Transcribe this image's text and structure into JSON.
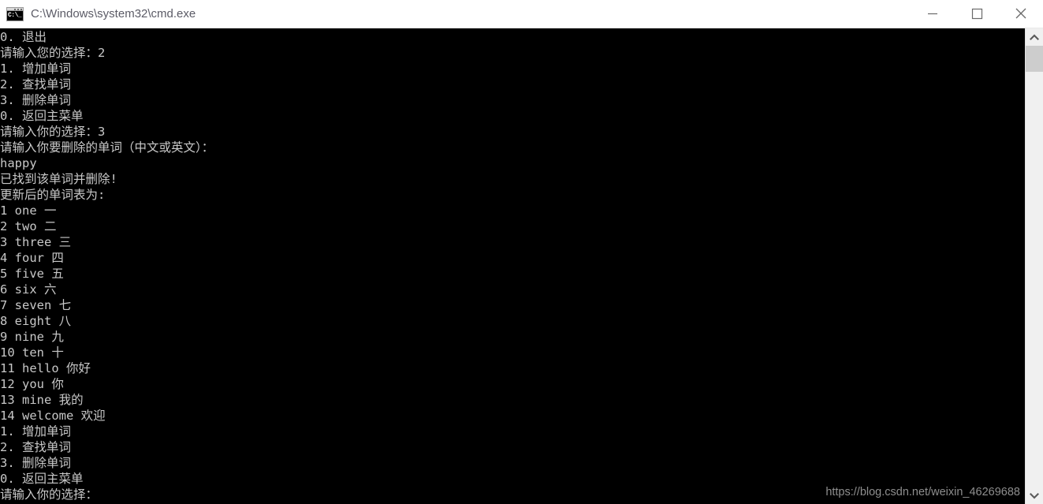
{
  "window": {
    "title": "C:\\Windows\\system32\\cmd.exe",
    "icon_name": "cmd-console-icon",
    "icon_glyph": "C:\\_",
    "controls": {
      "minimize_label": "Minimize",
      "maximize_label": "Maximize",
      "close_label": "Close"
    },
    "colors": {
      "titlebar_bg": "#ffffff",
      "title_text": "#5b5b66",
      "terminal_bg": "#000000",
      "terminal_text": "#c8c8c8",
      "scrollbar_track": "#f0f0f0",
      "scrollbar_thumb": "#cdcdcd",
      "watermark_text": "#8e8e8e"
    }
  },
  "terminal": {
    "lines": [
      "0. 退出",
      "请输入您的选择：2",
      "1. 增加单词",
      "2. 查找单词",
      "3. 删除单词",
      "0. 返回主菜单",
      "请输入你的选择：3",
      "请输入你要删除的单词（中文或英文）：",
      "happy",
      "已找到该单词并删除!",
      "更新后的单词表为:",
      "1 one 一",
      "2 two 二",
      "3 three 三",
      "4 four 四",
      "5 five 五",
      "6 six 六",
      "7 seven 七",
      "8 eight 八",
      "9 nine 九",
      "10 ten 十",
      "11 hello 你好",
      "12 you 你",
      "13 mine 我的",
      "14 welcome 欢迎",
      "1. 增加单词",
      "2. 查找单词",
      "3. 删除单词",
      "0. 返回主菜单",
      "请输入你的选择："
    ],
    "word_table": {
      "entries": [
        {
          "index": "1",
          "english": "one",
          "chinese": "一"
        },
        {
          "index": "2",
          "english": "two",
          "chinese": "二"
        },
        {
          "index": "3",
          "english": "three",
          "chinese": "三"
        },
        {
          "index": "4",
          "english": "four",
          "chinese": "四"
        },
        {
          "index": "5",
          "english": "five",
          "chinese": "五"
        },
        {
          "index": "6",
          "english": "six",
          "chinese": "六"
        },
        {
          "index": "7",
          "english": "seven",
          "chinese": "七"
        },
        {
          "index": "8",
          "english": "eight",
          "chinese": "八"
        },
        {
          "index": "9",
          "english": "nine",
          "chinese": "九"
        },
        {
          "index": "10",
          "english": "ten",
          "chinese": "十"
        },
        {
          "index": "11",
          "english": "hello",
          "chinese": "你好"
        },
        {
          "index": "12",
          "english": "you",
          "chinese": "你"
        },
        {
          "index": "13",
          "english": "mine",
          "chinese": "我的"
        },
        {
          "index": "14",
          "english": "welcome",
          "chinese": "欢迎"
        }
      ]
    },
    "menu_options": [
      "1. 增加单词",
      "2. 查找单词",
      "3. 删除单词",
      "0. 返回主菜单"
    ],
    "prompt_text": "请输入你的选择：",
    "user_inputs": [
      "2",
      "3",
      "happy"
    ]
  },
  "watermark": {
    "text": "https://blog.csdn.net/weixin_46269688"
  },
  "scrollbar": {
    "up_arrow": "▲",
    "down_arrow": "▼"
  }
}
